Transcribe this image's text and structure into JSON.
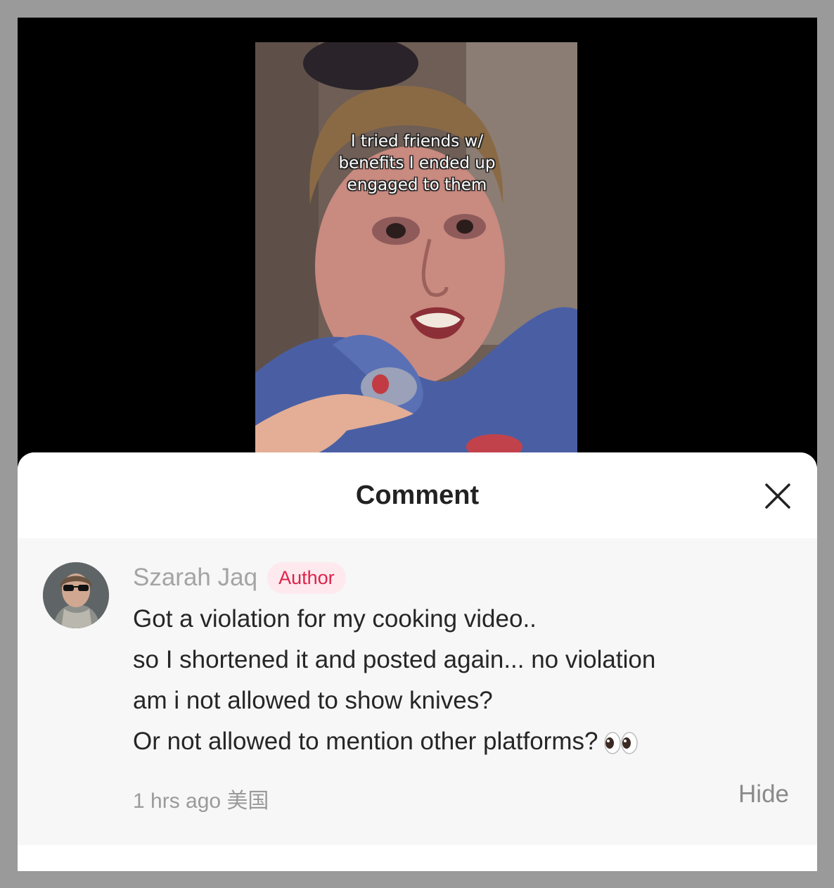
{
  "video": {
    "caption": "I tried friends w/\nbenefits I ended up\nengaged to them"
  },
  "sheet": {
    "title": "Comment",
    "close_icon": "close-icon"
  },
  "comment": {
    "author_name": "Szarah Jaq",
    "author_badge": "Author",
    "lines": [
      "Got a violation for my cooking video..",
      "so I shortened it and posted again... no violation",
      "am i not allowed to show knives?",
      "Or not allowed to mention other platforms?"
    ],
    "trailing_emoji_icon": "eyes-emoji-icon",
    "time": "1 hrs ago",
    "location": "美国",
    "hide_label": "Hide"
  },
  "colors": {
    "badge_text": "#e0234a",
    "badge_bg": "#fde9ee",
    "comment_bg": "#f7f7f7"
  }
}
